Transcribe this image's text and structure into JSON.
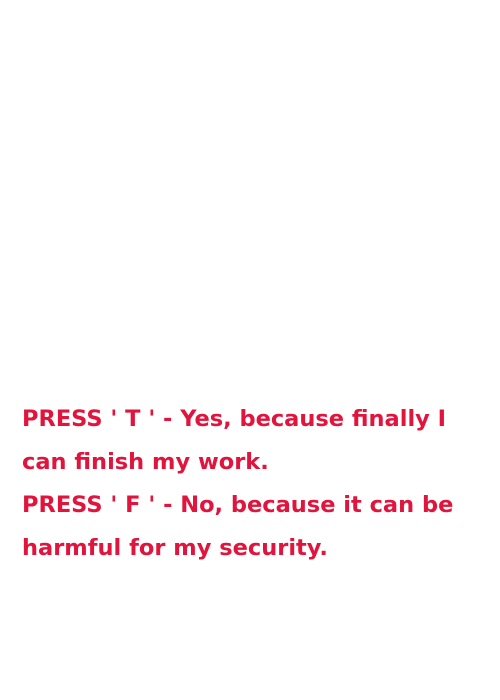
{
  "options": [
    {
      "text": "PRESS ' T ' - Yes, because finally I can finish my work."
    },
    {
      "text": "PRESS ' F ' - No, because it can be harmful for my security."
    }
  ],
  "colors": {
    "text": "#e0143c",
    "background": "#ffffff"
  }
}
